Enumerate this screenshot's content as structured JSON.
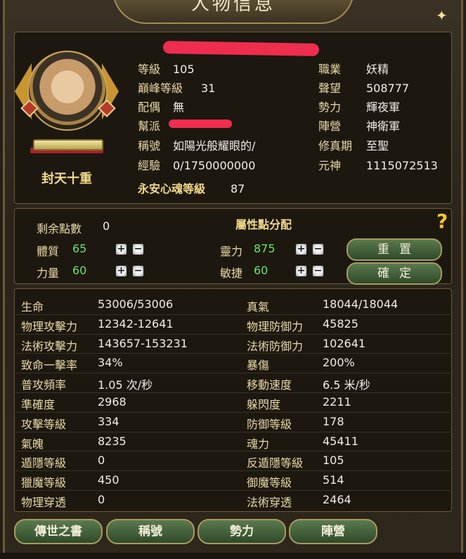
{
  "window": {
    "title": "人物信息"
  },
  "character": {
    "rank_title": "封天十重",
    "left_fields": [
      {
        "label": "等級",
        "value": "105"
      },
      {
        "label": "巔峰等級",
        "value": "31"
      },
      {
        "label": "配偶",
        "value": "無"
      },
      {
        "label": "幫派",
        "value": ""
      },
      {
        "label": "稱號",
        "value": "如陽光般耀眼的/"
      },
      {
        "label": "經驗",
        "value": "0/1750000000"
      }
    ],
    "soul_level": {
      "label": "永安心魂等級",
      "value": "87"
    },
    "right_fields": [
      {
        "label": "職業",
        "value": "妖精"
      },
      {
        "label": "聲望",
        "value": "508777"
      },
      {
        "label": "勢力",
        "value": "輝夜軍"
      },
      {
        "label": "陣營",
        "value": "神衛軍"
      },
      {
        "label": "修真期",
        "value": "至聖"
      },
      {
        "label": "元神",
        "value": "1115072513"
      }
    ]
  },
  "attributes": {
    "title": "屬性點分配",
    "remaining_label": "剩余點數",
    "remaining_value": "0",
    "items": [
      {
        "label": "體質",
        "value": "65"
      },
      {
        "label": "靈力",
        "value": "875"
      },
      {
        "label": "力量",
        "value": "60"
      },
      {
        "label": "敏捷",
        "value": "60"
      }
    ],
    "plus": "+",
    "minus": "−",
    "reset_label": "重置",
    "confirm_label": "確定"
  },
  "stats": [
    {
      "left_label": "生命",
      "left_value": "53006/53006",
      "right_label": "真氣",
      "right_value": "18044/18044"
    },
    {
      "left_label": "物理攻擊力",
      "left_value": "12342-12641",
      "right_label": "物理防御力",
      "right_value": "45825"
    },
    {
      "left_label": "法術攻擊力",
      "left_value": "143657-153231",
      "right_label": "法術防御力",
      "right_value": "102641"
    },
    {
      "left_label": "致命一擊率",
      "left_value": "34%",
      "right_label": "暴傷",
      "right_value": "200%"
    },
    {
      "left_label": "普攻頻率",
      "left_value": "1.05 次/秒",
      "right_label": "移動速度",
      "right_value": "6.5 米/秒"
    },
    {
      "left_label": "準確度",
      "left_value": "2968",
      "right_label": "躲閃度",
      "right_value": "2211"
    },
    {
      "left_label": "攻擊等級",
      "left_value": "334",
      "right_label": "防御等級",
      "right_value": "178"
    },
    {
      "left_label": "氣魄",
      "left_value": "8235",
      "right_label": "魂力",
      "right_value": "45411"
    },
    {
      "left_label": "遁隱等級",
      "left_value": "0",
      "right_label": "反遁隱等級",
      "right_value": "105"
    },
    {
      "left_label": "獵魔等級",
      "left_value": "450",
      "right_label": "御魔等級",
      "right_value": "514"
    },
    {
      "left_label": "物理穿透",
      "left_value": "0",
      "right_label": "法術穿透",
      "right_value": "2464"
    }
  ],
  "tabs": [
    {
      "label": "傳世之書"
    },
    {
      "label": "稱號"
    },
    {
      "label": "勢力"
    },
    {
      "label": "陣營"
    }
  ],
  "colors": {
    "accent_gold": "#f1d98a",
    "green_value": "#6ee46a",
    "redaction": "#ef2d4e"
  }
}
